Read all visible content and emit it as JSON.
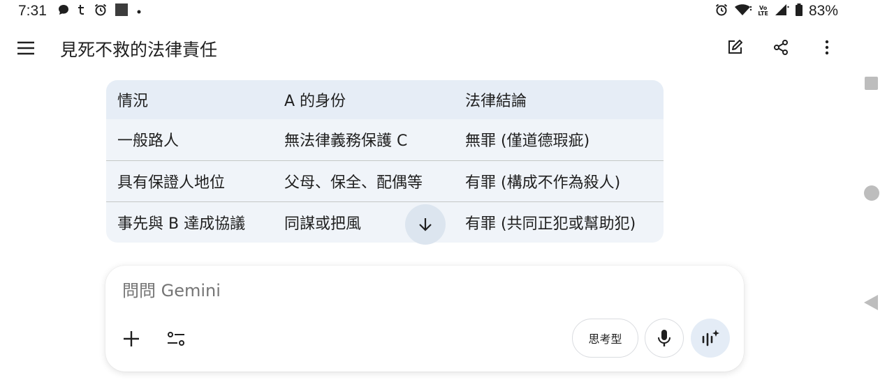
{
  "status_bar": {
    "time": "7:31",
    "left_icons": [
      "chat-bubble-icon",
      "threads-icon",
      "alarm-icon",
      "square-icon",
      "dot-icon"
    ],
    "right_icons": [
      "alarm-icon",
      "wifi-icon",
      "volte-icon",
      "signal-icon",
      "battery-icon"
    ],
    "volte_top": "Vo",
    "volte_bottom": "LTE",
    "battery": "83%"
  },
  "app_bar": {
    "title": "見死不救的法律責任",
    "actions": [
      "edit-icon",
      "share-icon",
      "more-vert-icon"
    ]
  },
  "table": {
    "headers": [
      "情況",
      "A 的身份",
      "法律結論"
    ],
    "rows": [
      [
        "一般路人",
        "無法律義務保護 C",
        "無罪 (僅道德瑕疵)"
      ],
      [
        "具有保證人地位",
        "父母、保全、配偶等",
        "有罪 (構成不作為殺人)"
      ],
      [
        "事先與 B 達成協議",
        "同謀或把風",
        "有罪 (共同正犯或幫助犯)"
      ]
    ]
  },
  "composer": {
    "placeholder": "問問 Gemini",
    "mode_label": "思考型"
  },
  "colors": {
    "table_bg": "#f0f4f9",
    "table_header_bg": "#e6edf6",
    "scroll_btn_bg": "#dce5ef",
    "live_btn_bg": "#e4ecf6"
  }
}
